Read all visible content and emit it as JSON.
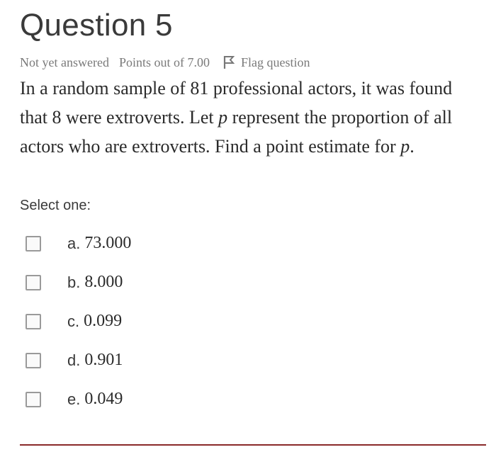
{
  "question": {
    "title": "Question 5",
    "status": "Not yet answered",
    "points": "Points out of 7.00",
    "flag_label": "Flag question",
    "text_part1": "In a random sample of 81 professional actors, it was found that 8 were extroverts. Let ",
    "var1": "p",
    "text_part2": " represent the proportion of all actors who are extroverts. Find a point estimate for ",
    "var2": "p",
    "text_part3": "."
  },
  "answers": {
    "prompt": "Select one:",
    "options": [
      {
        "letter": "a.",
        "value": "73.000"
      },
      {
        "letter": "b.",
        "value": "8.000"
      },
      {
        "letter": "c.",
        "value": "0.099"
      },
      {
        "letter": "d.",
        "value": "0.901"
      },
      {
        "letter": "e.",
        "value": "0.049"
      }
    ]
  },
  "colors": {
    "accent_rule": "#8a2a2a",
    "meta_text": "#7a7a7a"
  }
}
